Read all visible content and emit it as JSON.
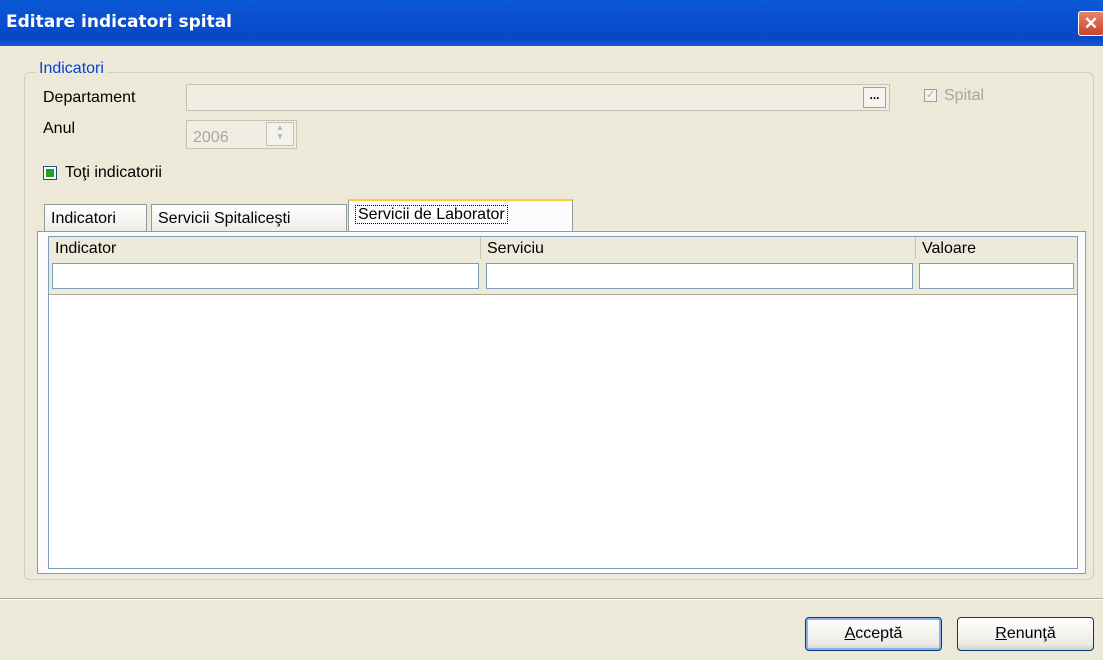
{
  "window": {
    "title": "Editare indicatori spital",
    "close_glyph": "✕"
  },
  "group": {
    "legend": "Indicatori"
  },
  "form": {
    "departament_label": "Departament",
    "departament_value": "",
    "browse_button": "...",
    "spital_label": "Spital",
    "spital_checked": true,
    "anul_label": "Anul",
    "anul_value": "2006",
    "toti_label": "Toţi indicatorii",
    "toti_checked": true
  },
  "tabs": [
    {
      "label": "Indicatori",
      "active": false
    },
    {
      "label": "Servicii Spitaliceşti",
      "active": false
    },
    {
      "label": "Servicii de Laborator",
      "active": true
    }
  ],
  "grid": {
    "columns": [
      "Indicator",
      "Serviciu",
      "Valoare"
    ],
    "filter_values": [
      "",
      "",
      ""
    ],
    "rows": []
  },
  "buttons": {
    "accept_label_first": "A",
    "accept_label_rest": "cceptă",
    "cancel_label_first": "R",
    "cancel_label_rest": "enunţă"
  },
  "colors": {
    "titlebar": "#0a4fcf",
    "legend": "#0046d5",
    "dialog_bg": "#ece9d8"
  }
}
